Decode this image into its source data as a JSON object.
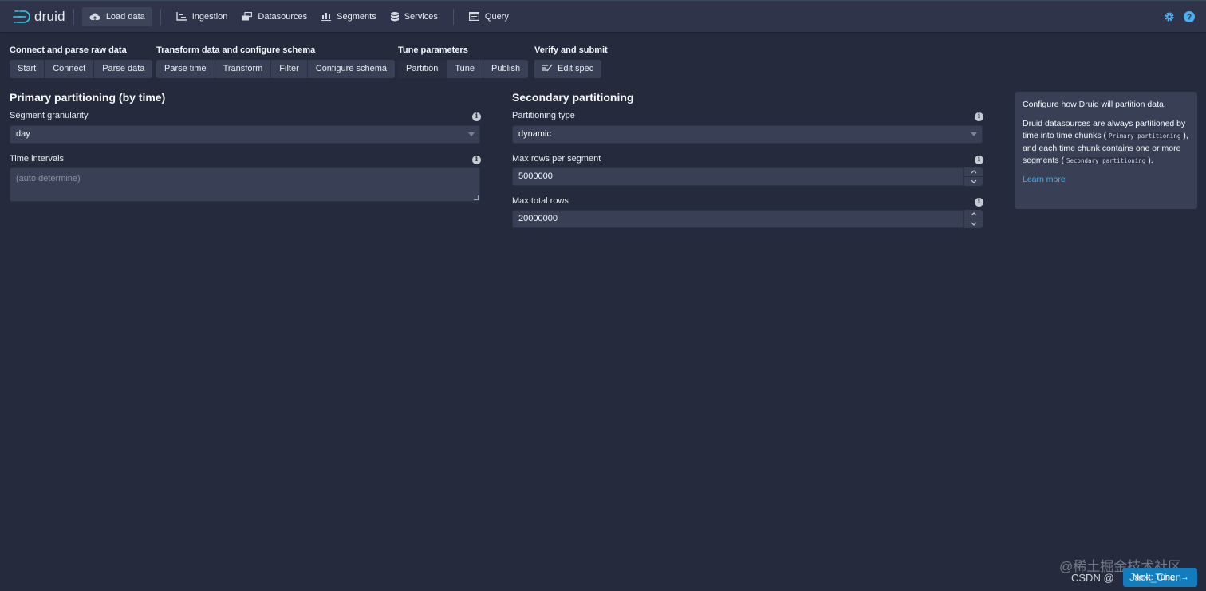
{
  "app": {
    "logo_text": "druid"
  },
  "nav": {
    "items": [
      {
        "label": "Load data",
        "icon": "cloud-upload-icon",
        "active": true
      },
      {
        "label": "Ingestion",
        "icon": "gantt-chart-icon"
      },
      {
        "label": "Datasources",
        "icon": "multi-select-icon"
      },
      {
        "label": "Segments",
        "icon": "stacked-chart-icon"
      },
      {
        "label": "Services",
        "icon": "database-icon"
      },
      {
        "label": "Query",
        "icon": "application-icon"
      }
    ],
    "right_icons": [
      "cog-icon",
      "help-icon"
    ]
  },
  "steps": [
    {
      "title": "Connect and parse raw data",
      "buttons": [
        "Start",
        "Connect",
        "Parse data"
      ]
    },
    {
      "title": "Transform data and configure schema",
      "buttons": [
        "Parse time",
        "Transform",
        "Filter",
        "Configure schema"
      ]
    },
    {
      "title": "Tune parameters",
      "buttons": [
        "Partition",
        "Tune",
        "Publish"
      ],
      "active": "Partition"
    },
    {
      "title": "Verify and submit",
      "buttons": [
        "Edit spec"
      ]
    }
  ],
  "primary": {
    "title": "Primary partitioning (by time)",
    "segment_granularity_label": "Segment granularity",
    "segment_granularity_value": "day",
    "time_intervals_label": "Time intervals",
    "time_intervals_placeholder": "(auto determine)"
  },
  "secondary": {
    "title": "Secondary partitioning",
    "partitioning_type_label": "Partitioning type",
    "partitioning_type_value": "dynamic",
    "max_rows_per_segment_label": "Max rows per segment",
    "max_rows_per_segment_value": "5000000",
    "max_total_rows_label": "Max total rows",
    "max_total_rows_value": "20000000"
  },
  "info_panel": {
    "line1": "Configure how Druid will partition data.",
    "para2_a": "Druid datasources are always partitioned by time into time chunks (",
    "code1": "Primary partitioning",
    "para2_b": "), and each time chunk contains one or more segments (",
    "code2": "Secondary partitioning",
    "para2_c": ").",
    "link": "Learn more"
  },
  "footer": {
    "watermark": "@稀土掘金技术社区",
    "csdn": "CSDN @",
    "next_label": "Next: Tune",
    "author": "Jack_Chen"
  },
  "colors": {
    "background": "#252a3d",
    "navbar": "#2f344a",
    "input": "#394055",
    "accent": "#48aff0",
    "primary_button": "#137cbd"
  }
}
